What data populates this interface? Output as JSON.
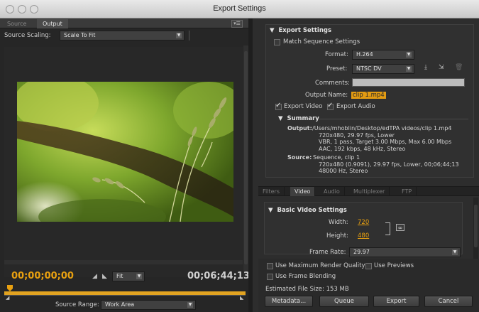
{
  "window": {
    "title": "Export Settings"
  },
  "left": {
    "tabs": [
      "Source",
      "Output"
    ],
    "source_scaling_label": "Source Scaling:",
    "source_scaling_value": "Scale To Fit",
    "current_time": "00;00;00;00",
    "fit_value": "Fit",
    "duration": "00;06;44;13",
    "source_range_label": "Source Range:",
    "source_range_value": "Work Area"
  },
  "export_settings": {
    "header": "Export Settings",
    "match_sequence": "Match Sequence Settings",
    "format_label": "Format:",
    "format_value": "H.264",
    "preset_label": "Preset:",
    "preset_value": "NTSC DV",
    "comments_label": "Comments:",
    "output_name_label": "Output Name:",
    "output_name_value": "clip 1.mp4",
    "export_video": "Export Video",
    "export_audio": "Export Audio",
    "summary_header": "Summary",
    "output_label": "Output:",
    "output_lines": [
      "/Users/mhoblin/Desktop/edTPA videos/clip 1.mp4",
      "720x480, 29.97 fps, Lower",
      "VBR, 1 pass, Target 3.00 Mbps, Max 6.00 Mbps",
      "AAC, 192 kbps, 48 kHz, Stereo"
    ],
    "source_label": "Source:",
    "source_lines": [
      "Sequence, clip 1",
      "720x480 (0.9091), 29.97 fps, Lower, 00;06;44;13",
      "48000 Hz, Stereo"
    ]
  },
  "subtabs": [
    "Filters",
    "Video",
    "Audio",
    "Multiplexer",
    "FTP"
  ],
  "video": {
    "header": "Basic Video Settings",
    "width_label": "Width:",
    "width_value": "720",
    "height_label": "Height:",
    "height_value": "480",
    "frame_rate_label": "Frame Rate:",
    "frame_rate_value": "29.97"
  },
  "bottom": {
    "max_render_quality": "Use Maximum Render Quality",
    "use_previews": "Use Previews",
    "frame_blending": "Use Frame Blending",
    "estimated_size": "Estimated File Size:  153 MB",
    "metadata_button": "Metadata...",
    "queue_button": "Queue",
    "export_button": "Export",
    "cancel_button": "Cancel"
  }
}
